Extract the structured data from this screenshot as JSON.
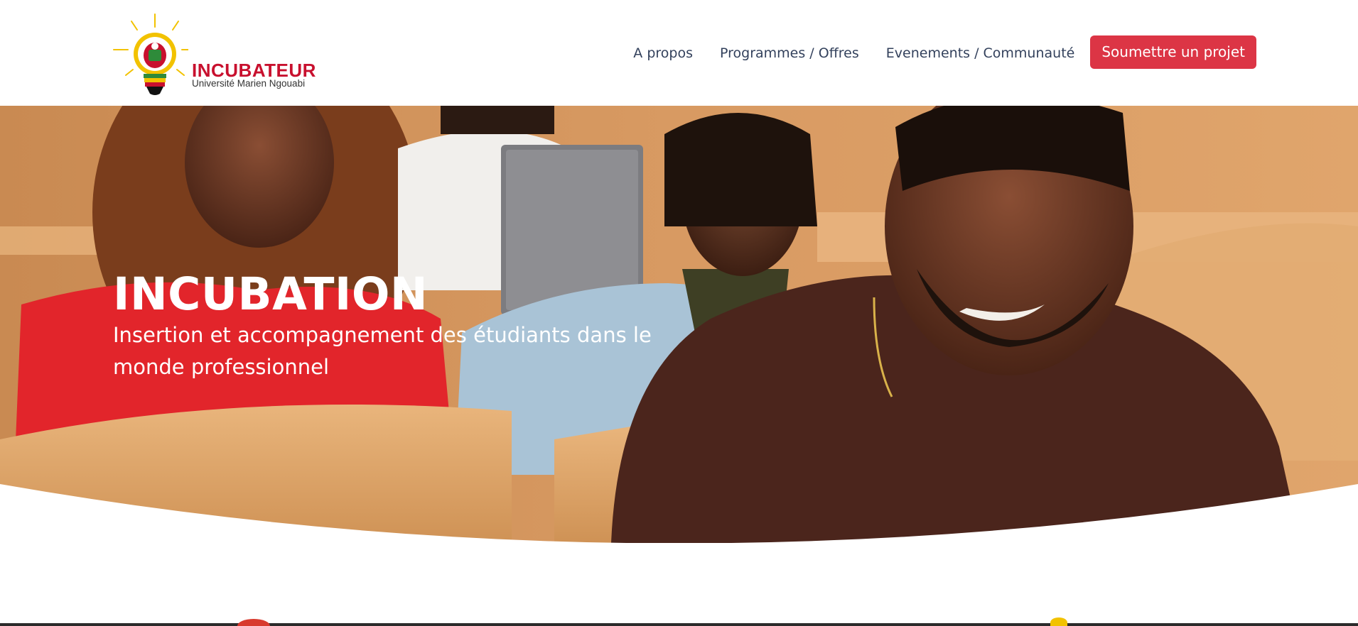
{
  "brand": {
    "name": "INCUBATEUR",
    "university": "Université Marien Ngouabi"
  },
  "nav": {
    "items": [
      {
        "label": "A propos"
      },
      {
        "label": "Programmes / Offres"
      },
      {
        "label": "Evenements / Communauté"
      }
    ],
    "cta_label": "Soumettre un projet"
  },
  "hero": {
    "title": "INCUBATION",
    "subtitle": "Insertion et accompagnement des étudiants dans le monde professionnel"
  },
  "colors": {
    "brand_red": "#c8102e",
    "cta_red": "#dc3545",
    "nav_text": "#33415c",
    "logo_yellow": "#f2c200"
  }
}
